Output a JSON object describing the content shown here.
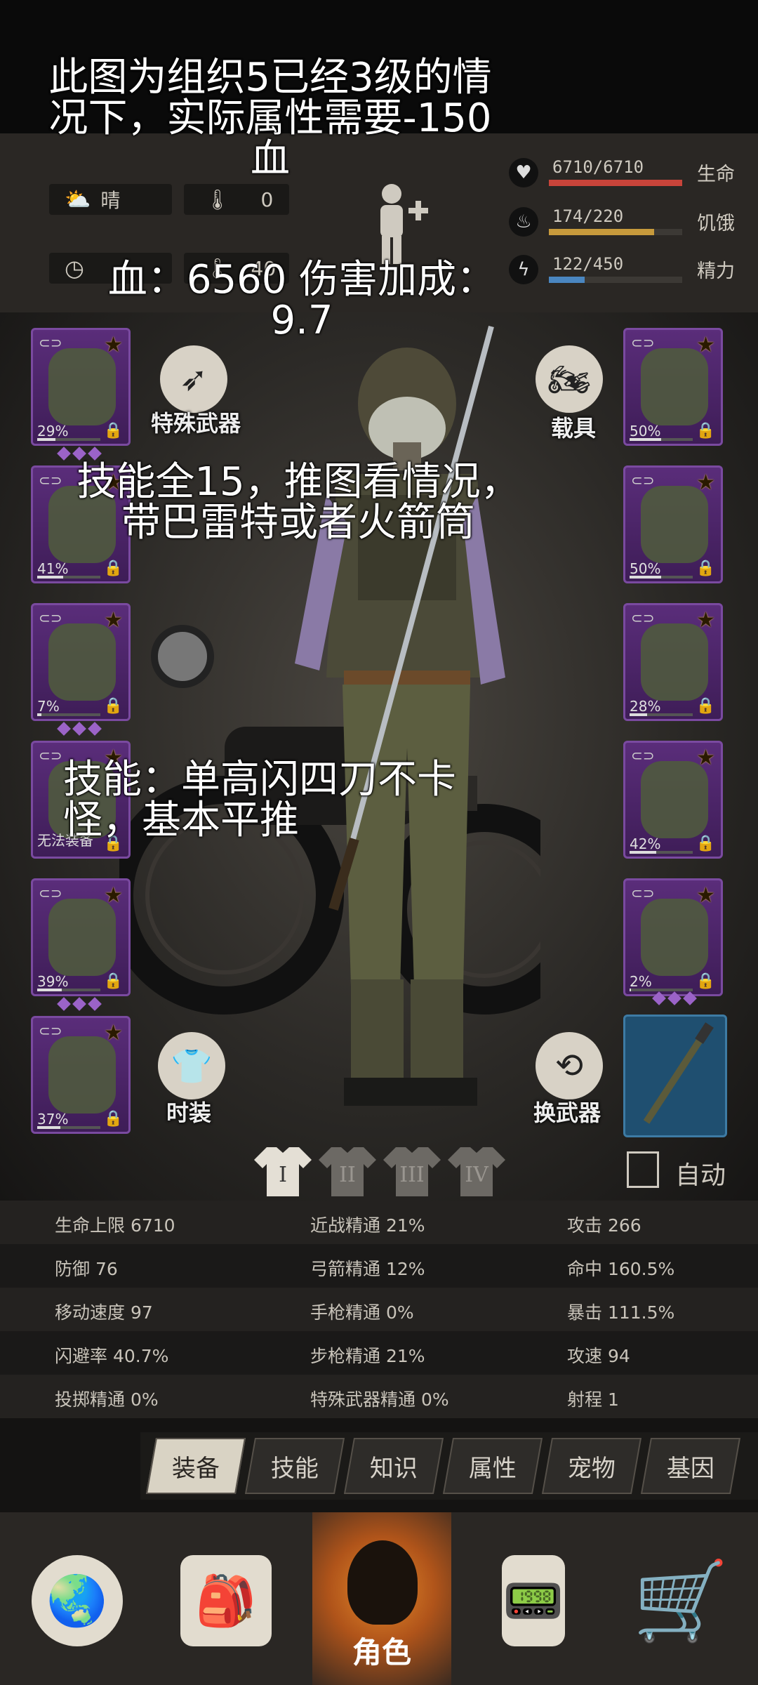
{
  "weather": {
    "condition": "晴",
    "temp": "0",
    "extra": "40"
  },
  "vitals": [
    {
      "icon": "heart-icon",
      "glyph": "♥",
      "value": "6710/6710",
      "label": "生命",
      "fill": 1.0,
      "color": "#c8443a"
    },
    {
      "icon": "stomach-icon",
      "glyph": "♨",
      "value": "174/220",
      "label": "饥饿",
      "fill": 0.79,
      "color": "#c79a3c"
    },
    {
      "icon": "lightning-icon",
      "glyph": "ϟ",
      "value": "122/450",
      "label": "精力",
      "fill": 0.27,
      "color": "#4a86c0"
    }
  ],
  "overlays": {
    "top": "此图为组织5已经3级的情况下，实际属性需要-150血",
    "stats": "血：6560 伤害加成：9.7",
    "skills": "技能全15，推图看情况，带巴雷特或者火箭筒",
    "tips": "技能：单高闪四刀不卡怪，基本平推"
  },
  "left_slots": [
    {
      "pct": "29%",
      "dur": 0.29,
      "dots": 3
    },
    {
      "pct": "41%",
      "dur": 0.41,
      "dots": 0
    },
    {
      "pct": "7%",
      "dur": 0.07,
      "dots": 3
    },
    {
      "pct": "",
      "dur": 0,
      "dots": 0,
      "note": "无法装备"
    },
    {
      "pct": "39%",
      "dur": 0.39,
      "dots": 3
    },
    {
      "pct": "37%",
      "dur": 0.37,
      "dots": 0
    }
  ],
  "right_slots": [
    {
      "pct": "50%",
      "dur": 0.5
    },
    {
      "pct": "50%",
      "dur": 0.5
    },
    {
      "pct": "28%",
      "dur": 0.28
    },
    {
      "pct": "42%",
      "dur": 0.42
    },
    {
      "pct": "2%",
      "dur": 0.02
    }
  ],
  "buttons": {
    "special_weapon": "特殊武器",
    "vehicle": "载具",
    "fashion": "时装",
    "switch_weapon": "换武器",
    "auto": "自动"
  },
  "presets": [
    "I",
    "II",
    "III",
    "IV"
  ],
  "stats": [
    [
      "生命上限 6710",
      "近战精通 21%",
      "攻击 266"
    ],
    [
      "防御 76",
      "弓箭精通 12%",
      "命中 160.5%"
    ],
    [
      "移动速度 97",
      "手枪精通 0%",
      "暴击 111.5%"
    ],
    [
      "闪避率 40.7%",
      "步枪精通 21%",
      "攻速 94"
    ],
    [
      "投掷精通 0%",
      "特殊武器精通 0%",
      "射程 1"
    ]
  ],
  "tabs": [
    "装备",
    "技能",
    "知识",
    "属性",
    "宠物",
    "基因"
  ],
  "nav": {
    "character": "角色"
  }
}
